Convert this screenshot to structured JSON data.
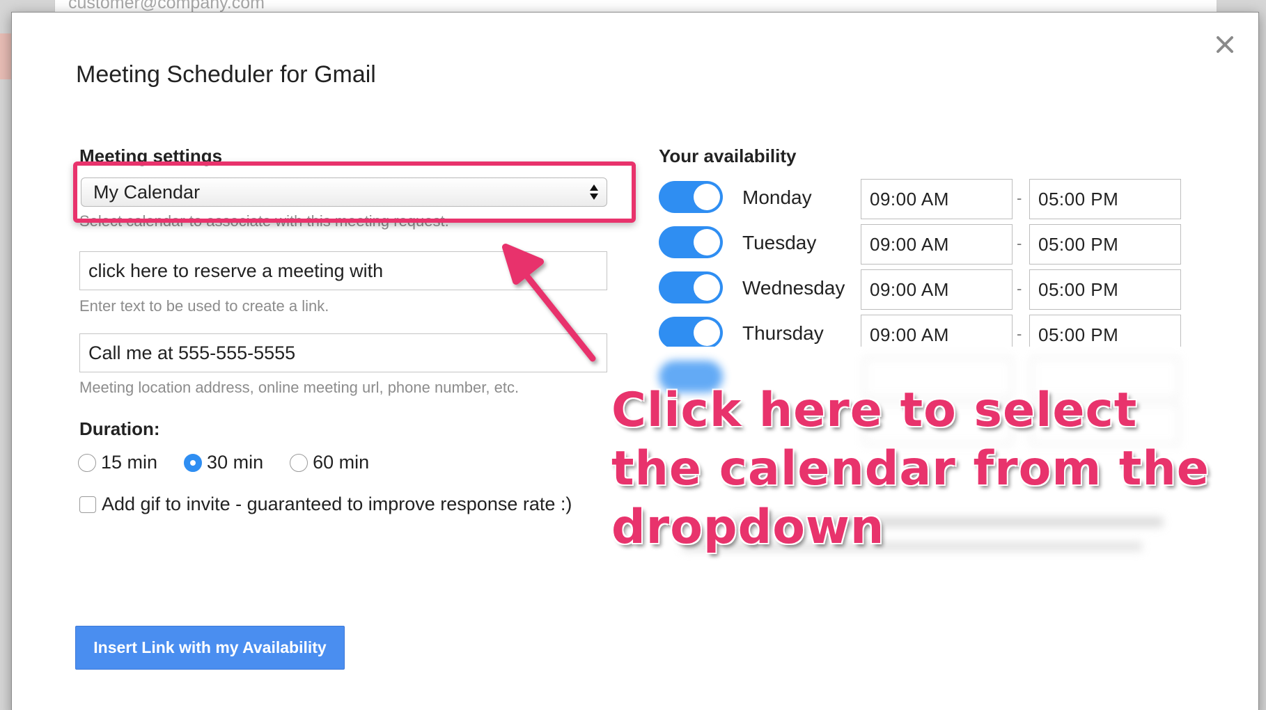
{
  "background": {
    "email_placeholder": "customer@company.com"
  },
  "modal": {
    "title": "Meeting Scheduler for Gmail",
    "close_icon": "close-icon"
  },
  "meeting_settings": {
    "heading": "Meeting settings",
    "calendar_select": {
      "value": "My Calendar",
      "helper": "Select calendar to associate with this meeting request."
    },
    "link_text": {
      "value": "click here to reserve a meeting with",
      "helper": "Enter text to be used to create a link."
    },
    "location": {
      "value": "Call me at 555-555-5555",
      "helper": "Meeting location address, online meeting url, phone number, etc."
    },
    "duration": {
      "label": "Duration:",
      "options": [
        "15 min",
        "30 min",
        "60 min"
      ],
      "selected": "30 min"
    },
    "gif_checkbox": {
      "label": "Add gif to invite - guaranteed to improve response rate :)",
      "checked": false
    },
    "insert_button": "Insert Link with my Availability"
  },
  "availability": {
    "heading": "Your availability",
    "days": [
      {
        "day": "Monday",
        "enabled": true,
        "start": "09:00  AM",
        "end": "05:00  PM"
      },
      {
        "day": "Tuesday",
        "enabled": true,
        "start": "09:00  AM",
        "end": "05:00  PM"
      },
      {
        "day": "Wednesday",
        "enabled": true,
        "start": "09:00  AM",
        "end": "05:00  PM"
      },
      {
        "day": "Thursday",
        "enabled": true,
        "start": "09:00  AM",
        "end": "05:00  PM"
      }
    ],
    "separator": "-"
  },
  "annotation": {
    "callout": "Click here to select the calendar from the dropdown",
    "accent_color": "#e8336c"
  },
  "colors": {
    "primary_blue": "#2f8ef2",
    "button_blue": "#4a8ef0"
  }
}
